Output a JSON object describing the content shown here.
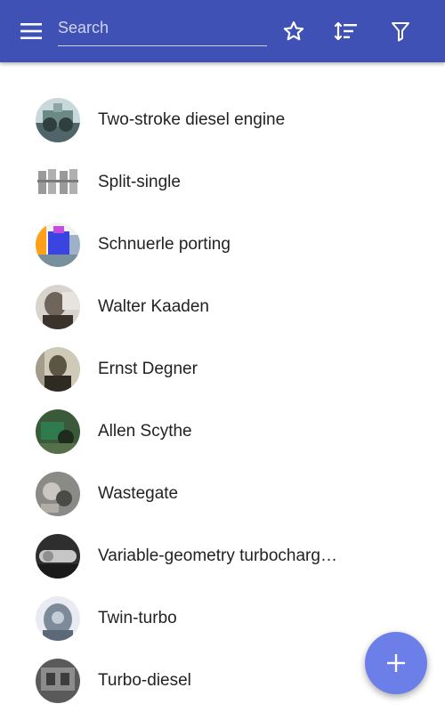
{
  "appbar": {
    "background": "#3f51b5",
    "menu_icon": "menu-icon",
    "search": {
      "placeholder": "Search",
      "value": ""
    },
    "actions": [
      "star-icon",
      "sort-icon",
      "filter-icon"
    ]
  },
  "list": {
    "items": [
      {
        "label": "Two-stroke diesel engine"
      },
      {
        "label": "Split-single"
      },
      {
        "label": "Schnuerle porting"
      },
      {
        "label": "Walter Kaaden"
      },
      {
        "label": "Ernst Degner"
      },
      {
        "label": "Allen Scythe"
      },
      {
        "label": "Wastegate"
      },
      {
        "label": "Variable-geometry turbocharg…"
      },
      {
        "label": "Twin-turbo"
      },
      {
        "label": "Turbo-diesel"
      }
    ]
  },
  "fab": {
    "icon": "plus-icon",
    "color": "#6c7fe9"
  }
}
